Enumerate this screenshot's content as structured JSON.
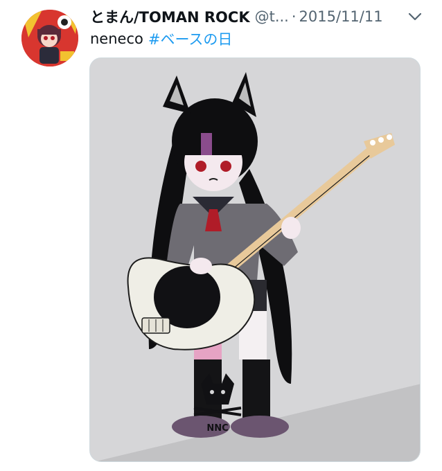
{
  "tweet": {
    "display_name": "とまん/TOMAN ROCK",
    "handle": "@t...",
    "separator": "·",
    "date": "2015/11/11",
    "text": "neneco",
    "hashtag": "#ベースの日",
    "more_icon": "chevron-down-icon"
  },
  "media": {
    "image_label": "NNC"
  },
  "colors": {
    "hashtag": "#1d9bf0",
    "name": "#0f1419",
    "muted": "#536471",
    "media_bg": "#d6d6d8"
  }
}
